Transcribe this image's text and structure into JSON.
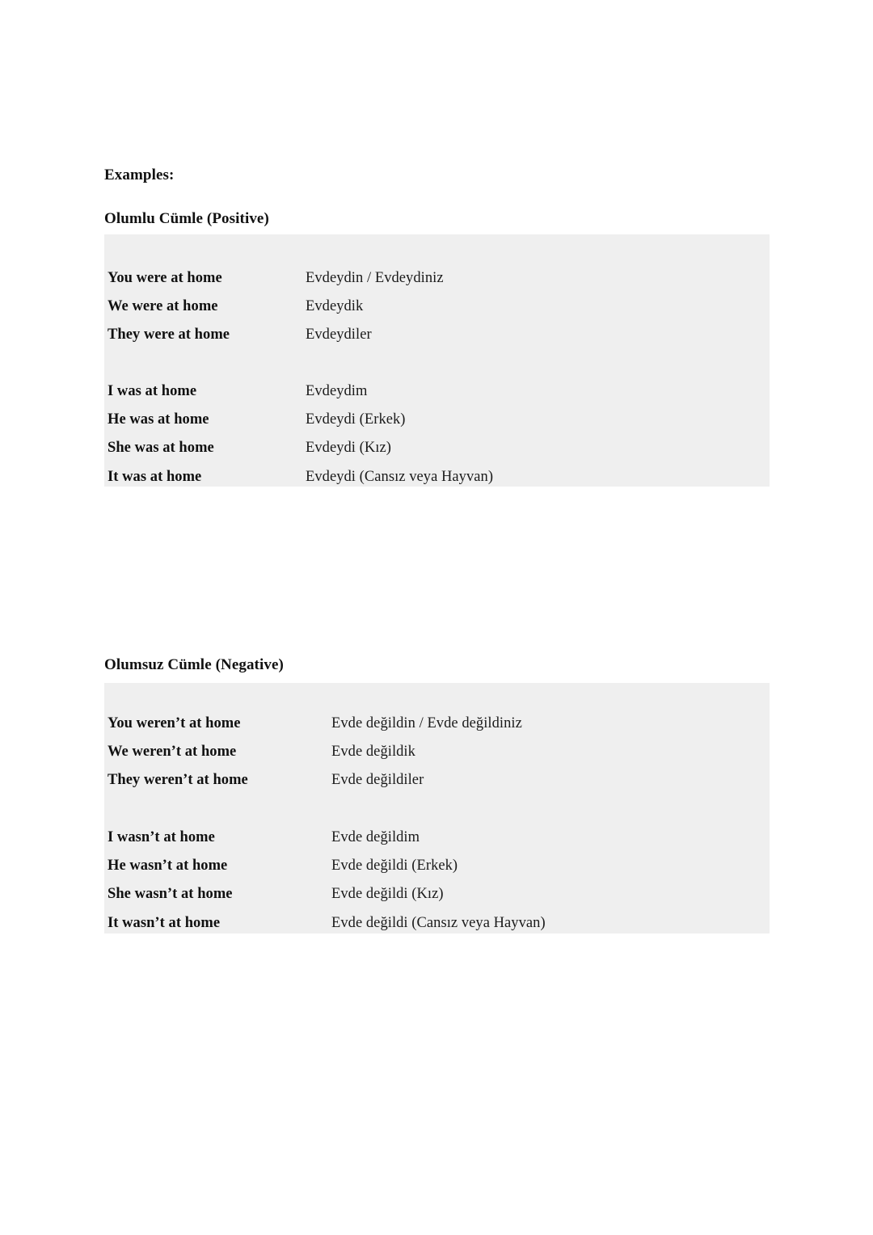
{
  "document": {
    "examples_heading": "Examples:",
    "sections": [
      {
        "heading": "Olumlu Cümle (Positive)",
        "groups": [
          {
            "rows": [
              {
                "english": "You were at home",
                "turkish": "Evdeydin / Evdeydiniz"
              },
              {
                "english": "We were at home",
                "turkish": "Evdeydik"
              },
              {
                "english": "They were at home",
                "turkish": "Evdeydiler"
              }
            ]
          },
          {
            "rows": [
              {
                "english": "I was at home",
                "turkish": "Evdeydim"
              },
              {
                "english": "He was at home",
                "turkish": "Evdeydi (Erkek)"
              },
              {
                "english": "She was at home",
                "turkish": "Evdeydi (Kız)"
              },
              {
                "english": "It was at home",
                "turkish": "Evdeydi (Cansız veya Hayvan)"
              }
            ]
          }
        ]
      },
      {
        "heading": "Olumsuz Cümle (Negative)",
        "groups": [
          {
            "rows": [
              {
                "english": "You weren’t at home",
                "turkish": "Evde değildin / Evde değildiniz"
              },
              {
                "english": "We weren’t at home",
                "turkish": "Evde değildik"
              },
              {
                "english": "They weren’t at home",
                "turkish": "Evde değildiler"
              }
            ]
          },
          {
            "rows": [
              {
                "english": "I wasn’t at home",
                "turkish": "Evde değildim"
              },
              {
                "english": "He wasn’t at home",
                "turkish": "Evde değildi (Erkek)"
              },
              {
                "english": "She wasn’t at home",
                "turkish": "Evde değildi (Kız)"
              },
              {
                "english": "It wasn’t at home",
                "turkish": "Evde değildi (Cansız veya Hayvan)"
              }
            ]
          }
        ]
      }
    ],
    "colors": {
      "page_background": "#ffffff",
      "block_background": "#efefef",
      "text": "#1a1a1a"
    }
  }
}
